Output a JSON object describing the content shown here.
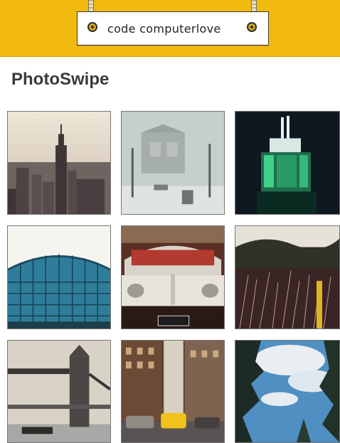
{
  "header": {
    "brand": "code computerlove",
    "background": "#f2b90f"
  },
  "page": {
    "title": "PhotoSwipe"
  },
  "gallery": {
    "items": [
      {
        "subject": "Empire State Building skyline"
      },
      {
        "subject": "Foggy street with fire hydrant"
      },
      {
        "subject": "Empire State Building lit at night"
      },
      {
        "subject": "Glass dome roof structure"
      },
      {
        "subject": "Vintage car front grille"
      },
      {
        "subject": "Overgrown brush with yellow pole"
      },
      {
        "subject": "Tower Bridge London"
      },
      {
        "subject": "City street with yellow taxis"
      },
      {
        "subject": "Trees against blue sky"
      }
    ]
  }
}
